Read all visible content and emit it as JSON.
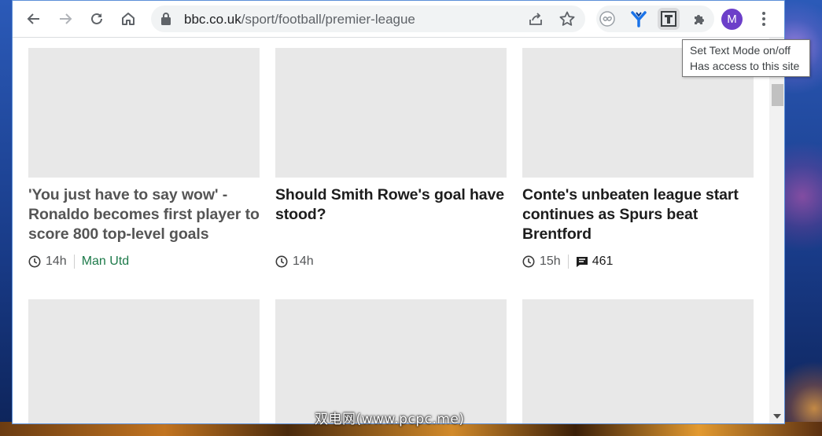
{
  "browser": {
    "url_domain": "bbc.co.uk",
    "url_path": "/sport/football/premier-league",
    "avatar_initial": "M"
  },
  "tooltip": {
    "line1": "Set Text Mode on/off",
    "line2": "Has access to this site"
  },
  "articles": [
    {
      "headline": "'You just have to say wow' - Ronaldo becomes first player to score 800 top-level goals",
      "time": "14h",
      "tag": "Man Utd",
      "visited": true
    },
    {
      "headline": "Should Smith Rowe's goal have stood?",
      "time": "14h"
    },
    {
      "headline": "Conte's unbeaten league start continues as Spurs beat Brentford",
      "time": "15h",
      "comments": "461"
    }
  ],
  "watermark": "双电网(www.pcpc.me)",
  "colors": {
    "accent_purple": "#6c3fc9",
    "tag_green": "#1d7a4a",
    "thumbnail_gray": "#e8e8e8"
  },
  "icons": [
    "back-icon",
    "forward-icon",
    "reload-icon",
    "home-icon",
    "lock-icon",
    "share-icon",
    "star-icon",
    "infinity-extension-icon",
    "y-extension-icon",
    "text-mode-extension-icon",
    "puzzle-icon",
    "more-vert-icon",
    "clock-icon",
    "comment-icon"
  ]
}
